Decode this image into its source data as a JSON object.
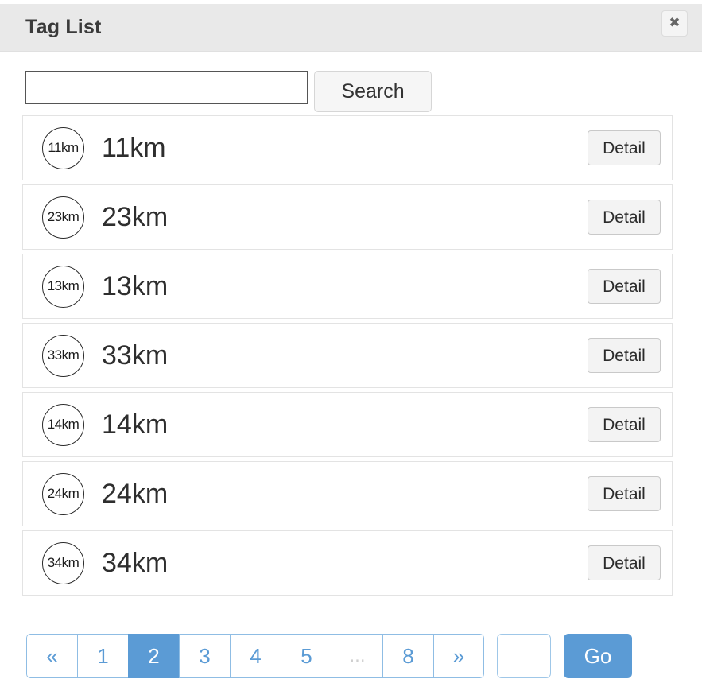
{
  "header": {
    "title": "Tag List",
    "close_label": "✖"
  },
  "search": {
    "value": "",
    "placeholder": "",
    "button_label": "Search"
  },
  "list": {
    "detail_label": "Detail",
    "rows": [
      {
        "badge": "11km",
        "label": "11km"
      },
      {
        "badge": "23km",
        "label": "23km"
      },
      {
        "badge": "13km",
        "label": "13km"
      },
      {
        "badge": "33km",
        "label": "33km"
      },
      {
        "badge": "14km",
        "label": "14km"
      },
      {
        "badge": "24km",
        "label": "24km"
      },
      {
        "badge": "34km",
        "label": "34km"
      }
    ]
  },
  "pagination": {
    "items": [
      {
        "label": "«",
        "name": "page-prev",
        "active": false,
        "ellipsis": false
      },
      {
        "label": "1",
        "name": "page-1",
        "active": false,
        "ellipsis": false
      },
      {
        "label": "2",
        "name": "page-2",
        "active": true,
        "ellipsis": false
      },
      {
        "label": "3",
        "name": "page-3",
        "active": false,
        "ellipsis": false
      },
      {
        "label": "4",
        "name": "page-4",
        "active": false,
        "ellipsis": false
      },
      {
        "label": "5",
        "name": "page-5",
        "active": false,
        "ellipsis": false
      },
      {
        "label": "...",
        "name": "page-ellipsis",
        "active": false,
        "ellipsis": true
      },
      {
        "label": "8",
        "name": "page-8",
        "active": false,
        "ellipsis": false
      },
      {
        "label": "»",
        "name": "page-next",
        "active": false,
        "ellipsis": false
      }
    ],
    "goto_value": "",
    "goto_placeholder": "",
    "go_label": "Go"
  },
  "colors": {
    "accent": "#5b9bd5",
    "header_bg": "#e9e9e9",
    "row_border": "#e3e3e3",
    "button_bg": "#f3f3f3"
  }
}
